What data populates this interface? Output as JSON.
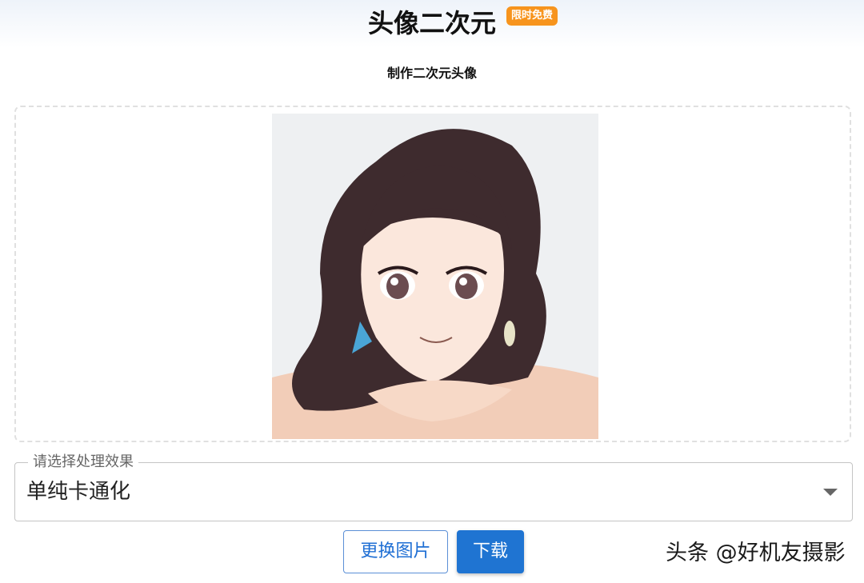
{
  "header": {
    "title": "头像二次元",
    "badge": "限时免费"
  },
  "subtitle": "制作二次元头像",
  "effect_select": {
    "label": "请选择处理效果",
    "value": "单纯卡通化"
  },
  "actions": {
    "change_image": "更换图片",
    "download": "下载"
  },
  "watermark": "头条 @好机友摄影",
  "colors": {
    "accent": "#1f74d2",
    "badge": "#f7941d"
  }
}
